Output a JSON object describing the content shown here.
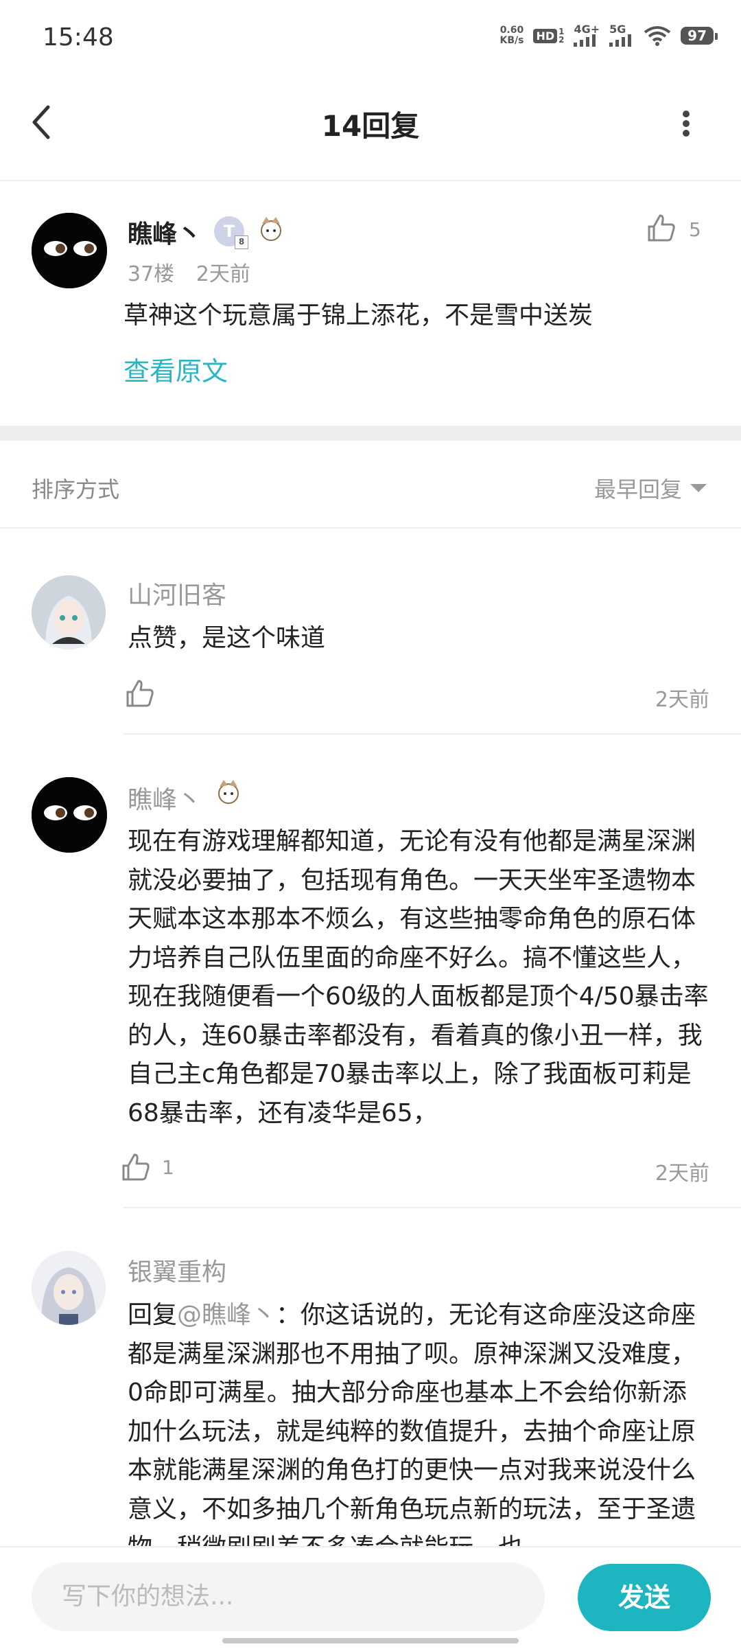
{
  "status_bar": {
    "time": "15:48",
    "net_speed_value": "0.60",
    "net_speed_unit": "KB/s",
    "hd": "HD",
    "hd_sub": "1",
    "hd_sub2": "2",
    "signal_4g": "4G+",
    "signal_5g": "5G",
    "battery": "97"
  },
  "header": {
    "title": "14回复"
  },
  "main_comment": {
    "username": "瞧峰丶",
    "badge_letter": "T",
    "badge_sub": "8",
    "floor": "37楼",
    "time": "2天前",
    "text": "草神这个玩意属于锦上添花，不是雪中送炭",
    "view_original": "查看原文",
    "likes": "5"
  },
  "sort": {
    "label": "排序方式",
    "selected": "最早回复"
  },
  "replies": [
    {
      "username": "山河旧客",
      "text": "点赞，是这个味道",
      "likes": "",
      "time": "2天前"
    },
    {
      "username": "瞧峰丶",
      "text": "现在有游戏理解都知道，无论有没有他都是满星深渊就没必要抽了，包括现有角色。一天天坐牢圣遗物本天赋本这本那本不烦么，有这些抽零命角色的原石体力培养自己队伍里面的命座不好么。搞不懂这些人，现在我随便看一个60级的人面板都是顶个4/50暴击率的人，连60暴击率都没有，看着真的像小丑一样，我自己主c角色都是70暴击率以上，除了我面板可莉是68暴击率，还有凌华是65，",
      "likes": "1",
      "time": "2天前"
    },
    {
      "username": "银翼重构",
      "reply_prefix": "回复",
      "mention": "@瞧峰丶",
      "reply_colon": "：",
      "text": "你这话说的，无论有这命座没这命座都是满星深渊那也不用抽了呗。原神深渊又没难度，0命即可满星。抽大部分命座也基本上不会给你新添加什么玩法，就是纯粹的数值提升，去抽个命座让原本就能满星深渊的角色打的更快一点对我来说没什么意义，不如多抽几个新角色玩点新的玩法，至于圣遗物，稍微刷刷差不多凑合就能玩，也"
    }
  ],
  "composer": {
    "placeholder": "写下你的想法...",
    "send_label": "发送"
  },
  "colors": {
    "accent": "#1db5c0",
    "link": "#2bb5c0"
  }
}
